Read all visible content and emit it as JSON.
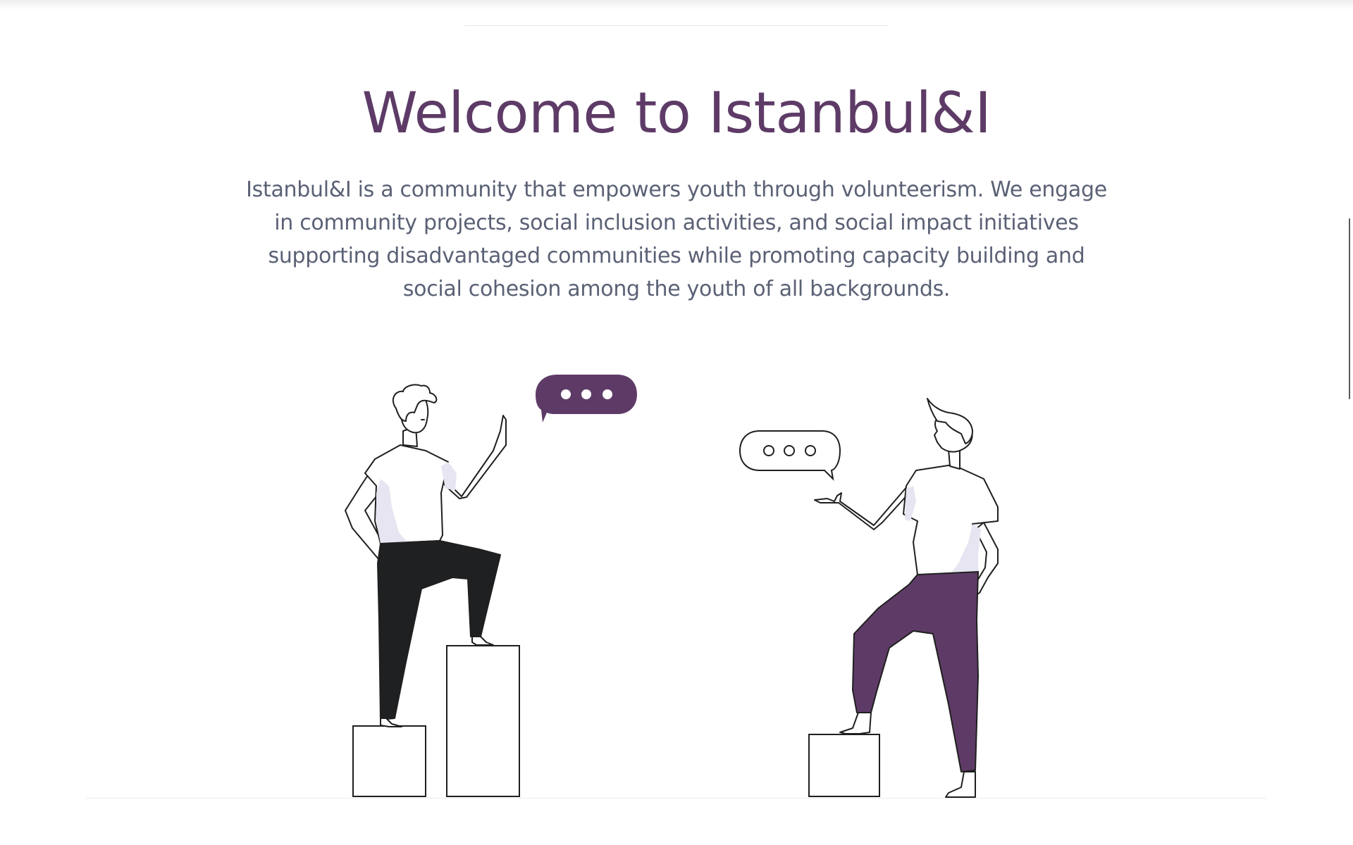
{
  "hero": {
    "title": "Welcome to Istanbul&I",
    "description": "Istanbul&I is a community that empowers youth through volunteerism. We engage in community projects, social inclusion activities, and social impact initiatives supporting disadvantaged communities while promoting capacity building and social cohesion among the youth of all backgrounds."
  },
  "illustration": {
    "icons": [
      "person-left-figure",
      "person-right-figure",
      "speech-bubble-filled-icon",
      "speech-bubble-outline-icon",
      "pedestal-box"
    ]
  },
  "colors": {
    "brand_purple": "#5e3b67",
    "text_gray": "#5a6175",
    "outline": "#1f1f1f",
    "pants_dark": "#1f2021",
    "shirt_shadow": "#e6e5f1"
  }
}
